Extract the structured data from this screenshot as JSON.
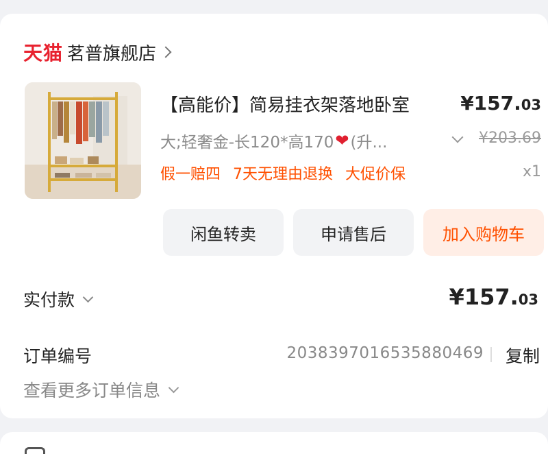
{
  "store": {
    "brand": "天猫",
    "name": "茗普旗舰店"
  },
  "product": {
    "title": "【高能价】简易挂衣架落地卧室",
    "price_main": "¥157.",
    "price_cents": "03",
    "sku_prefix": "大;轻奢金-长120*高170",
    "sku_suffix": "(升...",
    "original_price": "¥203.69",
    "promos": [
      "假一赔四",
      "7天无理由退换",
      "大促价保"
    ],
    "quantity": "x1"
  },
  "actions": {
    "resell": "闲鱼转卖",
    "after_sale": "申请售后",
    "add_cart": "加入购物车"
  },
  "payment": {
    "label": "实付款",
    "price_main": "¥157.",
    "price_cents": "03"
  },
  "order": {
    "label": "订单编号",
    "number": "2038397016535880469",
    "copy": "复制",
    "more": "查看更多订单信息"
  },
  "colors": {
    "tmall_red": "#e8222f",
    "promo_orange": "#ff5000",
    "cart_bg": "#ffeee6"
  }
}
